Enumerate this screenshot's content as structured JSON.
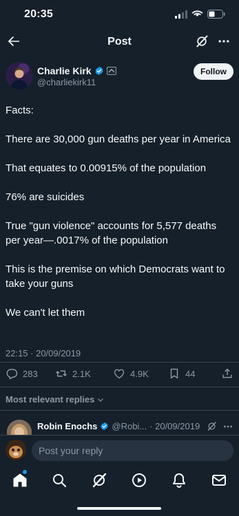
{
  "status_bar": {
    "time": "20:35"
  },
  "nav": {
    "title": "Post"
  },
  "author": {
    "name": "Charlie Kirk",
    "handle": "@charliekirk11",
    "follow_label": "Follow",
    "verified_color": "#1d9bf0"
  },
  "post": {
    "paragraphs": [
      "Facts:",
      "There are 30,000 gun deaths per year in America",
      "That equates to 0.00915% of the population",
      "76% are suicides",
      "True \"gun violence\" accounts for 5,577 deaths per year—.0017% of the population",
      "This is the premise on which Democrats want to take your guns",
      "We can't let them"
    ],
    "timestamp": "22:15 · 20/09/2019"
  },
  "actions": {
    "replies": "283",
    "reposts": "2.1K",
    "likes": "4.9K",
    "bookmarks": "44"
  },
  "replies_sort": {
    "label": "Most relevant replies"
  },
  "reply_preview": {
    "name": "Robin Enochs",
    "handle": "@Robi...",
    "date": "· 20/09/2019"
  },
  "composer": {
    "placeholder": "Post your reply"
  },
  "tabbar": {
    "items": [
      "home-icon",
      "search-icon",
      "grok-icon",
      "play-icon",
      "bell-icon",
      "mail-icon"
    ],
    "active": "home-icon"
  },
  "colors": {
    "background": "#15202b",
    "text_primary": "#f7f9f9",
    "text_secondary": "#8b98a5",
    "accent": "#1d9bf0",
    "divider": "#38444d"
  }
}
